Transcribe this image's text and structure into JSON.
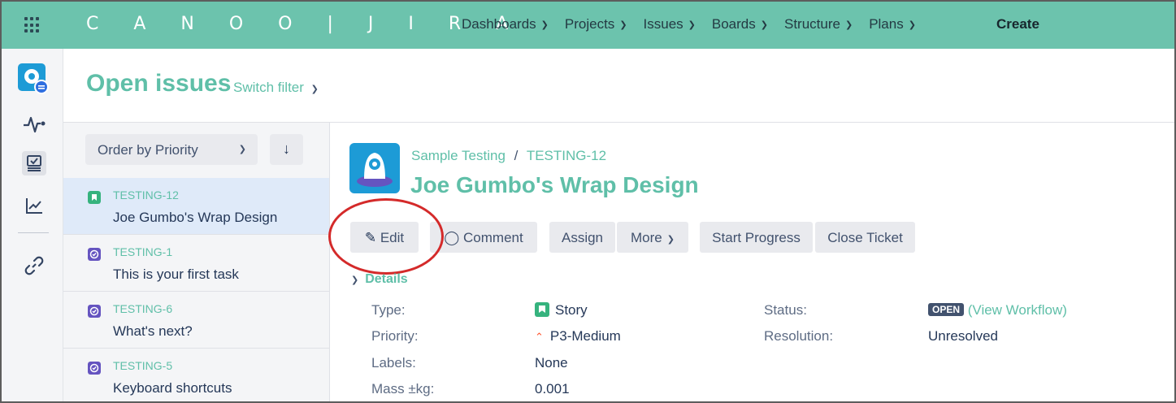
{
  "brand": "C A N O O | J I R A",
  "nav": {
    "items": [
      "Dashboards",
      "Projects",
      "Issues",
      "Boards",
      "Structure",
      "Plans"
    ],
    "create": "Create"
  },
  "header": {
    "title": "Open issues",
    "switch_filter": "Switch filter"
  },
  "list": {
    "order_by": "Order by Priority",
    "sort_icon": "arrow-down-icon",
    "items": [
      {
        "key": "TESTING-12",
        "title": "Joe Gumbo's Wrap Design",
        "type": "story",
        "active": true
      },
      {
        "key": "TESTING-1",
        "title": "This is your first task",
        "type": "task",
        "active": false
      },
      {
        "key": "TESTING-6",
        "title": "What's next?",
        "type": "task",
        "active": false
      },
      {
        "key": "TESTING-5",
        "title": "Keyboard shortcuts",
        "type": "task",
        "active": false
      }
    ]
  },
  "issue": {
    "project": "Sample Testing",
    "key": "TESTING-12",
    "title": "Joe Gumbo's Wrap Design"
  },
  "actions": {
    "edit": "Edit",
    "comment": "Comment",
    "assign": "Assign",
    "more": "More",
    "start_progress": "Start Progress",
    "close_ticket": "Close Ticket"
  },
  "details": {
    "heading": "Details",
    "type_label": "Type:",
    "type_value": "Story",
    "priority_label": "Priority:",
    "priority_value": "P3-Medium",
    "labels_label": "Labels:",
    "labels_value": "None",
    "mass_label": "Mass ±kg:",
    "mass_value": "0.001",
    "status_label": "Status:",
    "status_value": "OPEN",
    "view_workflow": "(View Workflow)",
    "resolution_label": "Resolution:",
    "resolution_value": "Unresolved"
  },
  "colors": {
    "topbar": "#6cc3ad",
    "accent": "#5fbfa8",
    "story": "#36b37e",
    "task": "#6554c0",
    "annotation": "#d42a2a"
  }
}
